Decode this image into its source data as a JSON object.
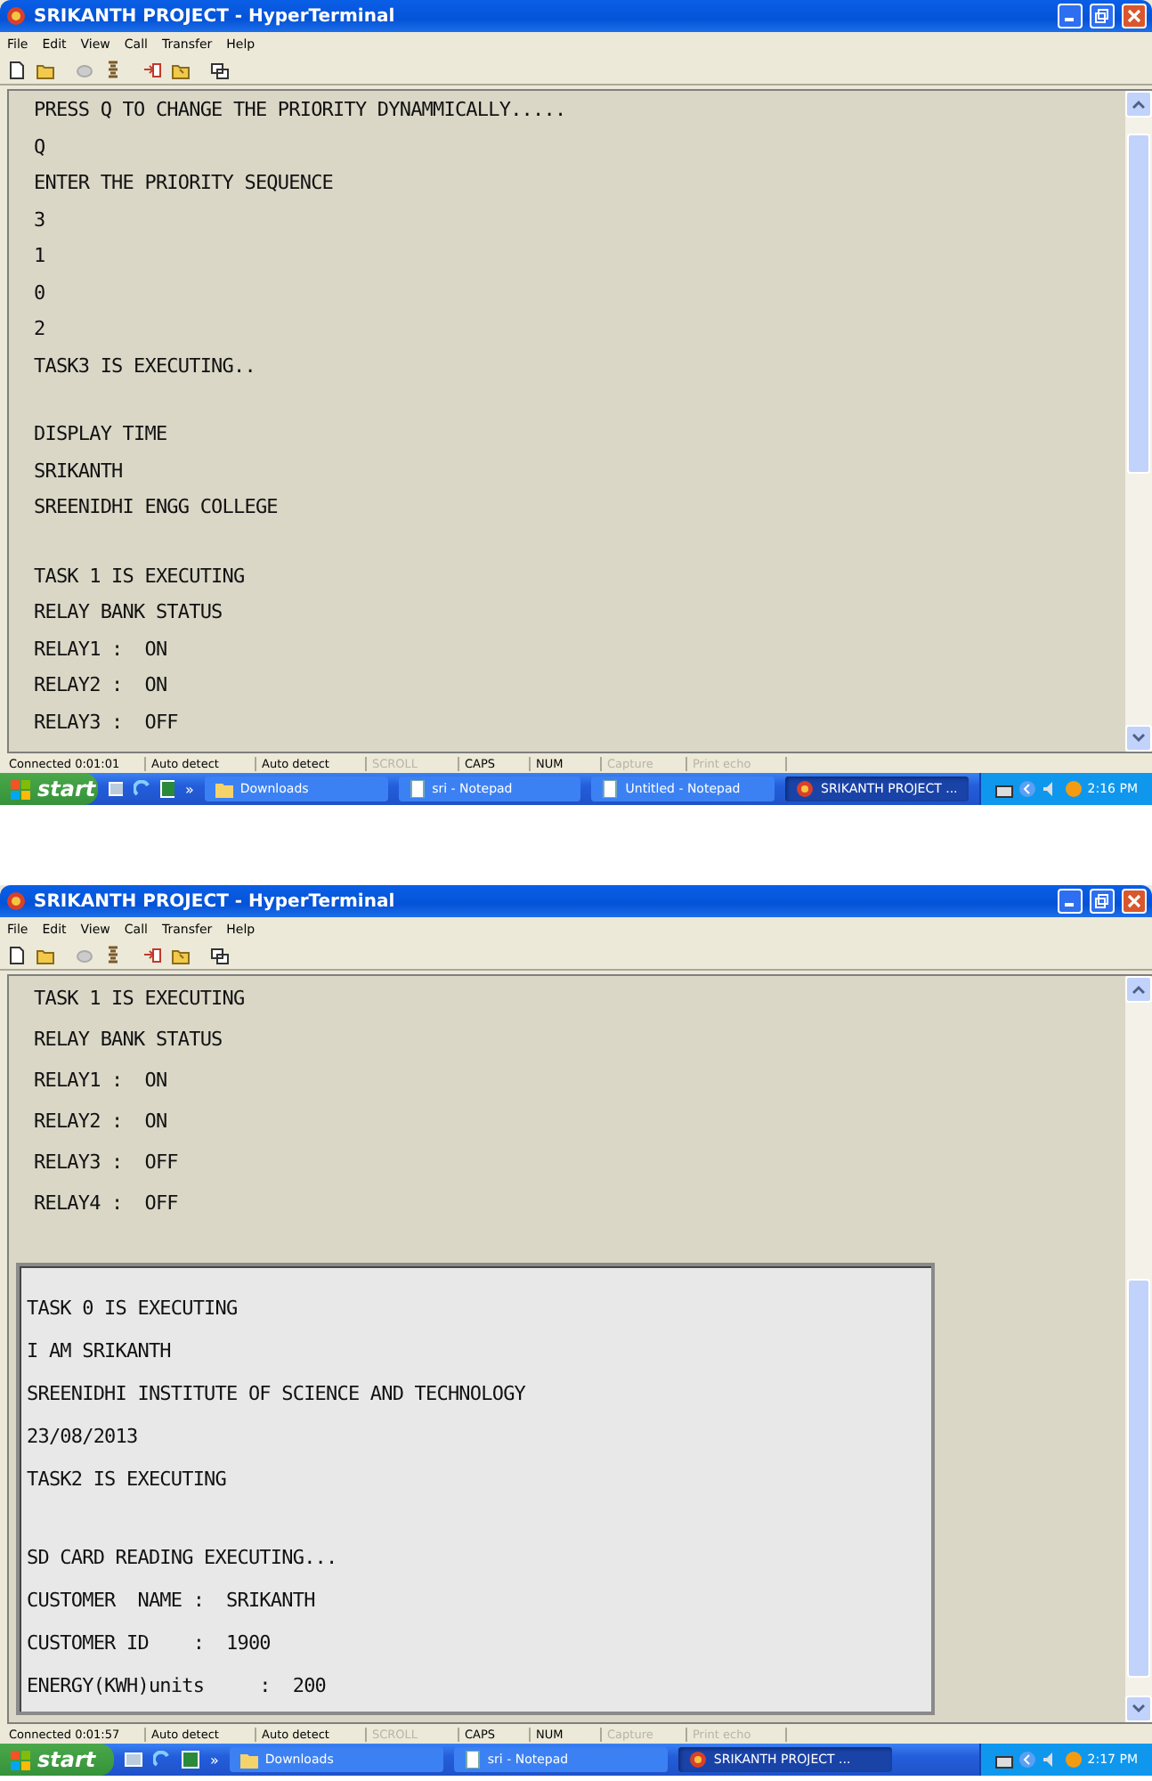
{
  "windows": [
    {
      "title": "SRIKANTH PROJECT - HyperTerminal",
      "menu": [
        "File",
        "Edit",
        "View",
        "Call",
        "Transfer",
        "Help"
      ],
      "terminal": {
        "blocks": [
          [
            "PRESS Q TO CHANGE THE PRIORITY DYNAMMICALLY.....",
            "Q",
            "ENTER THE PRIORITY SEQUENCE",
            "3",
            "1",
            "0",
            "2",
            "TASK3 IS EXECUTING.."
          ],
          [
            "DISPLAY TIME",
            "SRIKANTH",
            "SREENIDHI ENGG COLLEGE"
          ],
          [
            "TASK 1 IS EXECUTING",
            "RELAY BANK STATUS",
            "RELAY1 :  ON",
            "RELAY2 :  ON",
            "RELAY3 :  OFF"
          ]
        ]
      },
      "status_bar": [
        {
          "text": "Connected 0:01:01",
          "disabled": false
        },
        {
          "text": "Auto detect",
          "disabled": false
        },
        {
          "text": "Auto detect",
          "disabled": false
        },
        {
          "text": "SCROLL",
          "disabled": true
        },
        {
          "text": "CAPS",
          "disabled": false
        },
        {
          "text": "NUM",
          "disabled": false
        },
        {
          "text": "Capture",
          "disabled": true
        },
        {
          "text": "Print echo",
          "disabled": true
        }
      ],
      "taskbar": {
        "start": "start",
        "more": "»",
        "tasks": [
          {
            "label": "Downloads",
            "kind": "folder",
            "selected": false
          },
          {
            "label": "sri - Notepad",
            "kind": "notepad",
            "selected": false
          },
          {
            "label": "Untitled - Notepad",
            "kind": "notepad",
            "selected": false
          },
          {
            "label": "SRIKANTH PROJECT ...",
            "kind": "terminal",
            "selected": true
          }
        ],
        "clock": "2:16 PM"
      }
    },
    {
      "title": "SRIKANTH PROJECT - HyperTerminal",
      "menu": [
        "File",
        "Edit",
        "View",
        "Call",
        "Transfer",
        "Help"
      ],
      "terminal": {
        "blocks": [
          [
            "TASK 1 IS EXECUTING",
            "RELAY BANK STATUS",
            "RELAY1 :  ON",
            "RELAY2 :  ON",
            "RELAY3 :  OFF",
            "RELAY4 :  OFF"
          ]
        ],
        "panel_blocks": [
          [
            "TASK 0 IS EXECUTING",
            "I AM SRIKANTH",
            "SREENIDHI INSTITUTE OF SCIENCE AND TECHNOLOGY",
            "23/08/2013",
            "TASK2 IS EXECUTING"
          ],
          [
            "SD CARD READING EXECUTING...",
            "CUSTOMER  NAME :  SRIKANTH",
            "CUSTOMER ID    :  1900",
            "ENERGY(KWH)units     :  200"
          ]
        ]
      },
      "status_bar": [
        {
          "text": "Connected 0:01:57",
          "disabled": false
        },
        {
          "text": "Auto detect",
          "disabled": false
        },
        {
          "text": "Auto detect",
          "disabled": false
        },
        {
          "text": "SCROLL",
          "disabled": true
        },
        {
          "text": "CAPS",
          "disabled": false
        },
        {
          "text": "NUM",
          "disabled": false
        },
        {
          "text": "Capture",
          "disabled": true
        },
        {
          "text": "Print echo",
          "disabled": true
        }
      ],
      "taskbar": {
        "start": "start",
        "more": "»",
        "tasks": [
          {
            "label": "Downloads",
            "kind": "folder",
            "selected": false
          },
          {
            "label": "sri - Notepad",
            "kind": "notepad",
            "selected": false
          },
          {
            "label": "SRIKANTH PROJECT ...",
            "kind": "terminal",
            "selected": true
          }
        ],
        "clock": "2:17 PM"
      }
    }
  ]
}
